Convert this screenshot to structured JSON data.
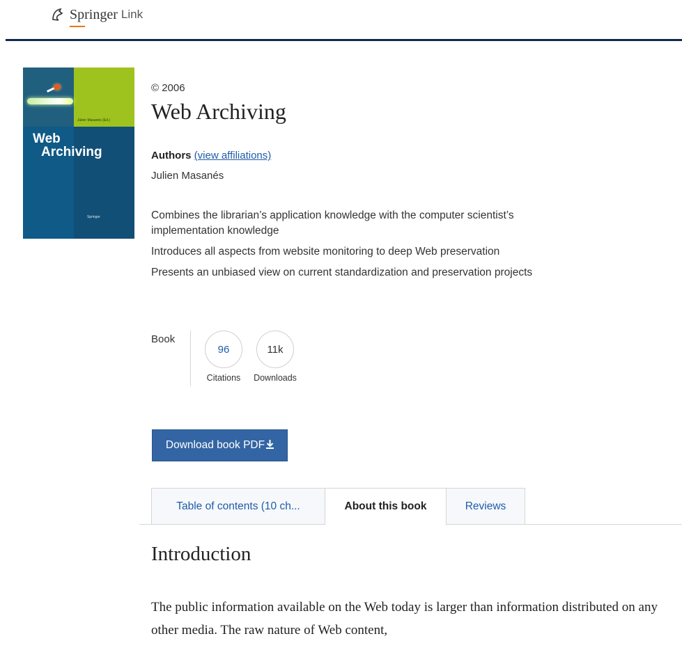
{
  "header": {
    "brand": "Springer",
    "product": "Link"
  },
  "cover": {
    "title_line1": "Web",
    "title_line2": "Archiving",
    "author_small": "Julien Masanés (Ed.)",
    "publisher_small": "Springer"
  },
  "book": {
    "copyright": "© 2006",
    "title": "Web Archiving",
    "authors_label": "Authors",
    "view_affiliations": "(view affiliations)",
    "author": "Julien Masanés",
    "highlights": [
      "Combines the librarian’s application knowledge with the computer scientist’s implementation knowledge",
      "Introduces all aspects from website monitoring to deep Web preservation",
      "Presents an unbiased view on current standardization and preservation projects"
    ]
  },
  "metrics": {
    "type": "Book",
    "citations_value": "96",
    "citations_label": "Citations",
    "downloads_value": "11k",
    "downloads_label": "Downloads"
  },
  "download": {
    "label": "Download book PDF",
    "icon": "download-icon"
  },
  "tabs": [
    {
      "label": "Table of contents (10 ch...",
      "active": false
    },
    {
      "label": "About this book",
      "active": true
    },
    {
      "label": "Reviews",
      "active": false
    }
  ],
  "section": {
    "heading": "Introduction",
    "text": "The public information available on the Web today is larger than information distributed on any other media. The raw nature of Web content,"
  },
  "colors": {
    "header_rule": "#0e2a4e",
    "link": "#1f5ca8",
    "button": "#3365a4",
    "brand_accent": "#e8770d"
  }
}
